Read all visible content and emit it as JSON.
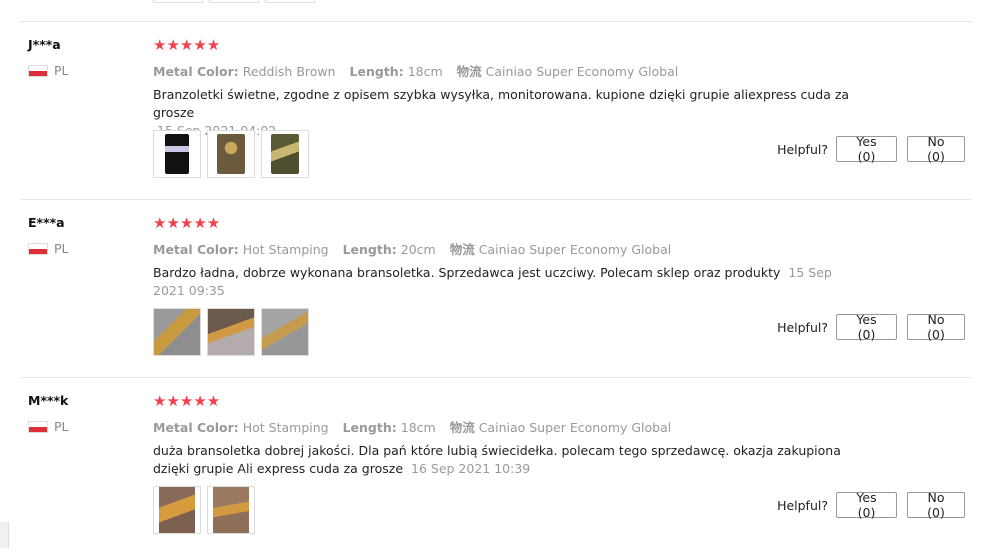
{
  "labels": {
    "metal_color": "Metal Color:",
    "length": "Length:",
    "shipping": "物流",
    "helpful": "Helpful?"
  },
  "reviews": [
    {
      "user": "J***a",
      "country": "PL",
      "rating": 5,
      "stars": "★★★★★",
      "metal_color": "Reddish Brown",
      "length": "18cm",
      "shipping": "Cainiao Super Economy Global",
      "text": "Branzoletki świetne, zgodne z opisem szybka wysyłka, monitorowana. kupione dzięki grupie aliexpress cuda za grosze",
      "date": "15 Sep 2021 04:02",
      "photos": [
        "phone-photo",
        "bracelet-photo",
        "bracelet-photo"
      ],
      "yes": "Yes (0)",
      "no": "No (0)"
    },
    {
      "user": "E***a",
      "country": "PL",
      "rating": 5,
      "stars": "★★★★★",
      "metal_color": "Hot Stamping",
      "length": "20cm",
      "shipping": "Cainiao Super Economy Global",
      "text": "Bardzo ładna, dobrze wykonana bransoletka. Sprzedawca jest uczciwy. Polecam sklep oraz produkty",
      "date": "15 Sep 2021 09:35",
      "photos": [
        "bracelet-photo",
        "bracelet-photo",
        "bracelet-photo"
      ],
      "yes": "Yes (0)",
      "no": "No (0)"
    },
    {
      "user": "M***k",
      "country": "PL",
      "rating": 5,
      "stars": "★★★★★",
      "metal_color": "Hot Stamping",
      "length": "18cm",
      "shipping": "Cainiao Super Economy Global",
      "text": "duża bransoletka dobrej jakości. Dla pań które lubią świecidełka. polecam tego sprzedawcę. okazja zakupiona dzięki grupie Ali express cuda za grosze",
      "date": "16 Sep 2021 10:39",
      "photos": [
        "bracelet-photo",
        "bracelet-photo"
      ],
      "yes": "Yes (0)",
      "no": "No (0)"
    }
  ]
}
